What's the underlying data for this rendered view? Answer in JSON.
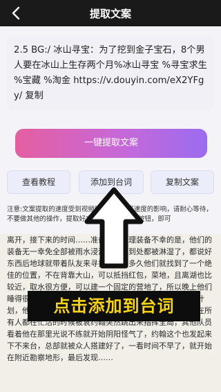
{
  "header": {
    "title": "提取文案",
    "back_icon": "chevron-left-icon"
  },
  "text_area": {
    "value": "2.5 BG:/ 冰山寻宝：为了挖到金子宝石，8个男人要在冰山上生存两个月%冰山寻宝 %寻宝求生 %宝藏 %淘金 https://v.douyin.com/eX2YFgy/ 复制"
  },
  "primary_button": {
    "label": "一键提取文案"
  },
  "actions": [
    {
      "label": "查看教程"
    },
    {
      "label": "添加到台词"
    },
    {
      "label": "复制文案"
    }
  ],
  "notice": "注意:文案提取的速度受到视频时长度，网络速度的影响，请耐心等待，不要做其他的操作，提取好文案之后点击复制按钮，即可",
  "article": "离开，接下来的时间……准备冒雨整理装备不幸的是，他们的装备无一幸免全部被雨水浸湿，仓促到处都被淋湿了，都说好东西后地球就带着队友来寻找地，没多久他们就找到了一个绝佳的位置，不在背靠大山，可以抵挡红包，菜地，且离湖也比较近，取水很方便，可以建一个固定的营地了，所以晚上他们睡得很不好，不过今天的天气不错，就往他要开始下一个计划，他们要搭建总部，这里开会和存放宝贝的地方，但就在所有人都在忙活的时候被袁约翰突然跳出来指挥全局，其他队员看着他在那里光说不练就开始阴阳怪气了，约翰这个也发起来下不来台，总部就被众人搭建好了，一看时间不早了，就开始在附近勘察地形，最后发现……",
  "overlay_caption": "点击添加到台词",
  "colors": {
    "header_bg": "#1a1a1a",
    "overlay_text": "#f7d417",
    "gradient_start": "#e45fa0",
    "gradient_end": "#9b6cf0"
  }
}
